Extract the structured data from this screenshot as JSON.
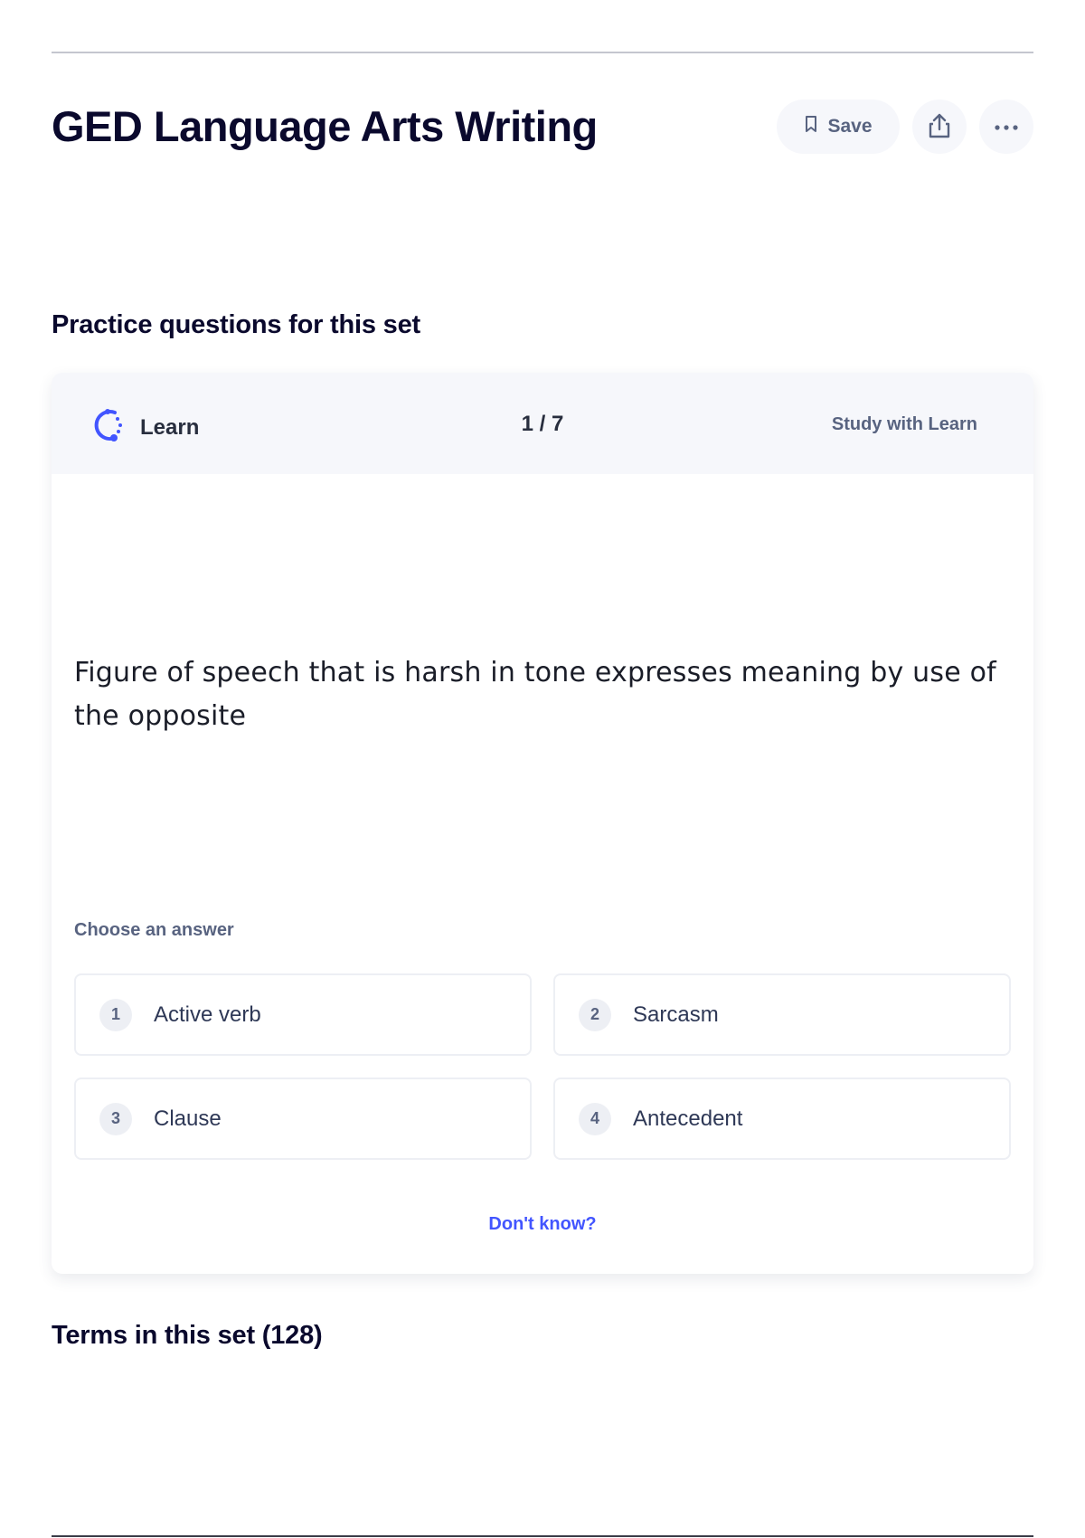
{
  "header": {
    "title": "GED Language Arts Writing",
    "save_label": "Save",
    "share_icon": "share-icon",
    "more_icon": "more-icon",
    "save_icon": "bookmark-icon"
  },
  "practice": {
    "heading": "Practice questions for this set",
    "mode_label": "Learn",
    "progress": "1 / 7",
    "study_link": "Study with Learn",
    "question": "Figure of speech that is harsh in tone expresses meaning by use of the opposite",
    "choose_label": "Choose an answer",
    "answers": [
      {
        "number": "1",
        "text": "Active verb"
      },
      {
        "number": "2",
        "text": "Sarcasm"
      },
      {
        "number": "3",
        "text": "Clause"
      },
      {
        "number": "4",
        "text": "Antecedent"
      }
    ],
    "dont_know": "Don't know?"
  },
  "terms": {
    "heading": "Terms in this set (128)"
  },
  "colors": {
    "accent": "#4255ff",
    "text_primary": "#0a092d",
    "text_secondary": "#586380",
    "header_bg": "#f6f7fb"
  }
}
